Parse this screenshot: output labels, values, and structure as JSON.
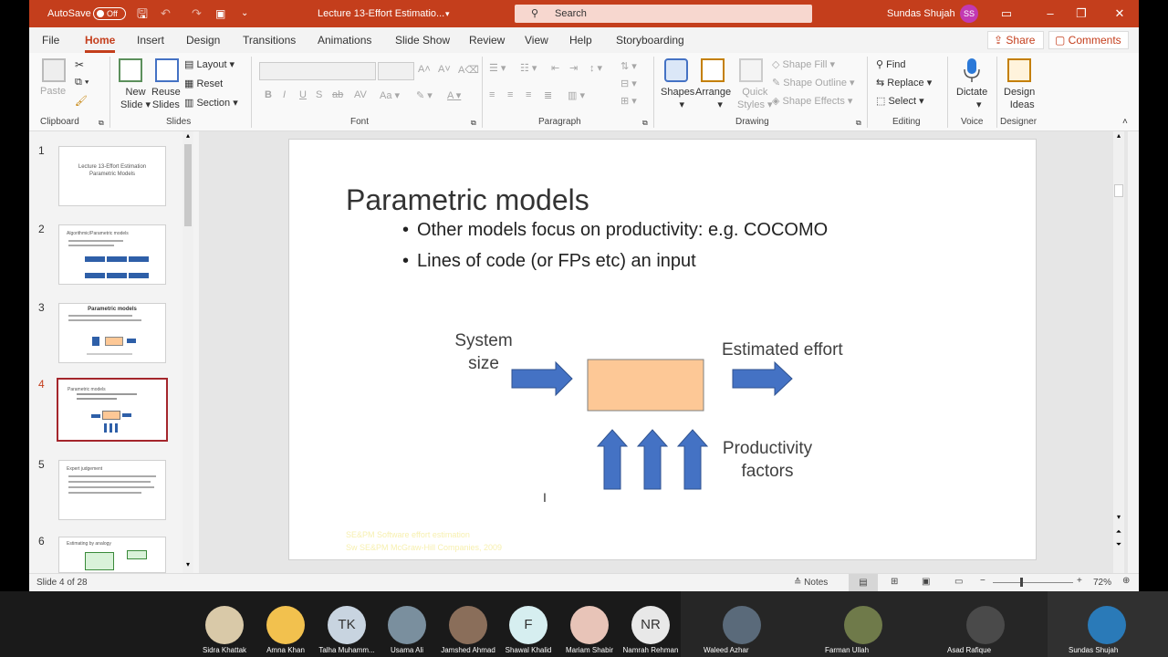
{
  "titlebar": {
    "autosave_label": "AutoSave",
    "autosave_state": "Off",
    "doc_title": "Lecture 13-Effort Estimatio...",
    "search_placeholder": "Search",
    "user_name": "Sundas Shujah",
    "user_initials": "SS"
  },
  "menu": {
    "tabs": [
      "File",
      "Home",
      "Insert",
      "Design",
      "Transitions",
      "Animations",
      "Slide Show",
      "Review",
      "View",
      "Help",
      "Storyboarding"
    ],
    "active_tab": "Home",
    "share_label": "Share",
    "comments_label": "Comments"
  },
  "ribbon": {
    "clipboard": {
      "paste": "Paste",
      "label": "Clipboard"
    },
    "slides": {
      "new_slide": [
        "New",
        "Slide"
      ],
      "reuse_slides": [
        "Reuse",
        "Slides"
      ],
      "layout": "Layout",
      "reset": "Reset",
      "section": "Section",
      "label": "Slides"
    },
    "font": {
      "label": "Font"
    },
    "paragraph": {
      "label": "Paragraph"
    },
    "drawing": {
      "shapes": "Shapes",
      "arrange": "Arrange",
      "quick_styles": [
        "Quick",
        "Styles"
      ],
      "shape_fill": "Shape Fill",
      "shape_outline": "Shape Outline",
      "shape_effects": "Shape Effects",
      "label": "Drawing"
    },
    "editing": {
      "find": "Find",
      "replace": "Replace",
      "select": "Select",
      "label": "Editing"
    },
    "voice": {
      "dictate": "Dictate",
      "label": "Voice"
    },
    "designer": {
      "design_ideas": [
        "Design",
        "Ideas"
      ],
      "label": "Designer"
    }
  },
  "thumbnails": {
    "numbers": [
      "1",
      "2",
      "3",
      "4",
      "5",
      "6"
    ],
    "selected": "4",
    "slide1": {
      "title": "Lecture 13-Effort Estimation",
      "subtitle": "Parametric Models"
    },
    "slide2": {
      "title": "Algorithmic/Parametric models"
    },
    "slide3": {
      "title": "Parametric models"
    },
    "slide4": {
      "title": "Parametric models"
    },
    "slide5": {
      "title": "Expert judgement"
    },
    "slide6": {
      "title": "Estimating by analogy"
    }
  },
  "slide": {
    "title": "Parametric models",
    "bullets": [
      "Other models focus on productivity: e.g. COCOMO",
      "Lines of code (or FPs etc) an input"
    ],
    "diagram": {
      "input_label": [
        "System",
        "size"
      ],
      "output_label": "Estimated effort",
      "factors_label": [
        "Productivity",
        "factors"
      ],
      "box_color": "#fdc896",
      "arrow_color": "#4472c4"
    },
    "footer_faint": [
      "SE&PM Software effort estimation",
      "Sw SE&PM McGraw-Hill Companies, 2009"
    ]
  },
  "status": {
    "slide_position": "Slide 4 of 28",
    "notes_label": "Notes",
    "zoom": "72%"
  },
  "participants": [
    {
      "name": "Sidra Khattak",
      "initials": ""
    },
    {
      "name": "Amna Khan",
      "initials": ""
    },
    {
      "name": "Talha Muhamm...",
      "initials": "TK"
    },
    {
      "name": "Usama Ali",
      "initials": ""
    },
    {
      "name": "Jamshed Ahmad",
      "initials": ""
    },
    {
      "name": "Shawal Khalid",
      "initials": "F"
    },
    {
      "name": "Mariam Shabir",
      "initials": ""
    },
    {
      "name": "Namrah Rehman",
      "initials": "NR"
    },
    {
      "name": "Waleed Azhar",
      "initials": ""
    },
    {
      "name": "Farman Ullah",
      "initials": ""
    },
    {
      "name": "Asad Rafique",
      "initials": ""
    },
    {
      "name": "Sundas Shujah",
      "initials": ""
    }
  ]
}
